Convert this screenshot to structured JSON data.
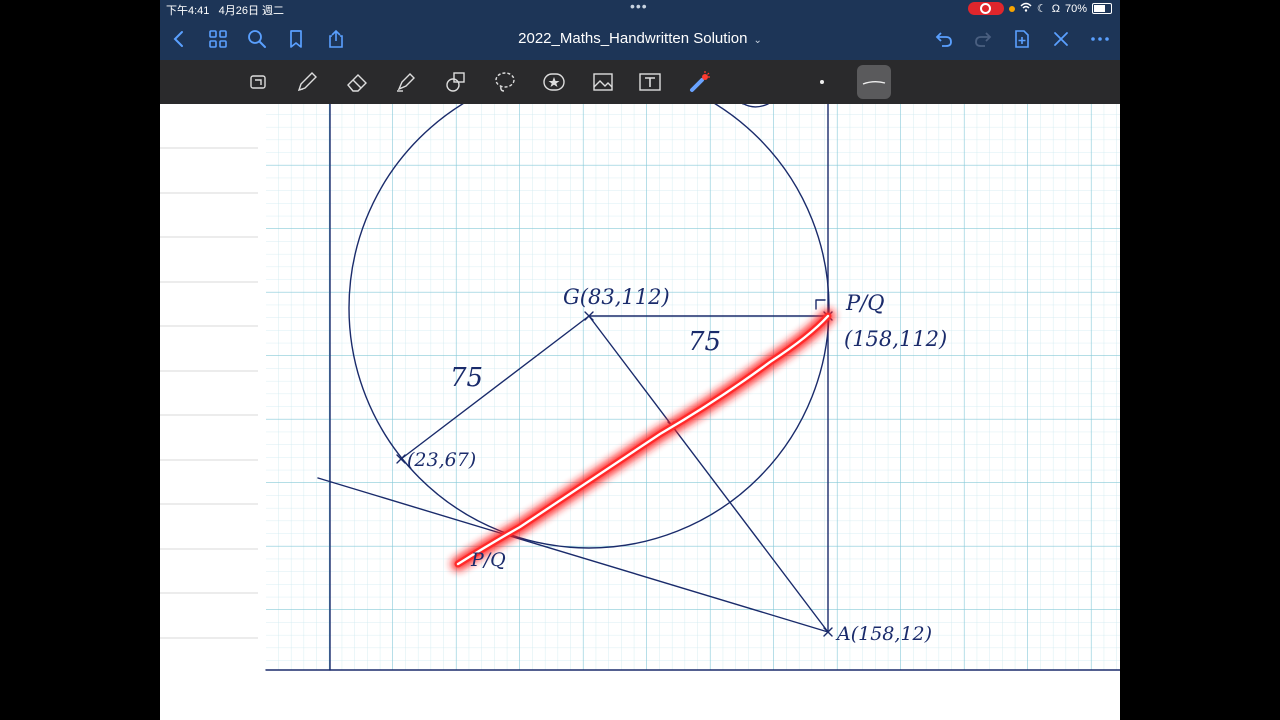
{
  "status": {
    "time": "下午4:41",
    "date": "4月26日 週二",
    "battery": "70%"
  },
  "nav": {
    "title": "2022_Maths_Handwritten Solution"
  },
  "icons": [
    "back-icon",
    "grid-icon",
    "search-icon",
    "bookmark-icon",
    "share-icon",
    "undo-icon",
    "redo-icon",
    "add-page-icon",
    "close-icon",
    "more-icon"
  ],
  "tools": [
    "lasso-crop-icon",
    "pen-icon",
    "eraser-icon",
    "highlighter-icon",
    "shapes-icon",
    "lasso-icon",
    "sticker-icon",
    "image-icon",
    "text-icon",
    "laser-pointer-icon"
  ],
  "notes": {
    "G": "G(83,112)",
    "PQ_right": "P/Q",
    "PQ_right_coord": "(158,112)",
    "len1": "75",
    "len2": "75",
    "point_left": "(23,67)",
    "PQ_left": "P/Q",
    "A": "A(158,12)"
  },
  "colors": {
    "ink": "#1a2b6b",
    "grid_major": "#7fc7d6",
    "grid_minor": "#cde9ef",
    "laser": "#ff1a1a",
    "bar": "#1d3557"
  }
}
